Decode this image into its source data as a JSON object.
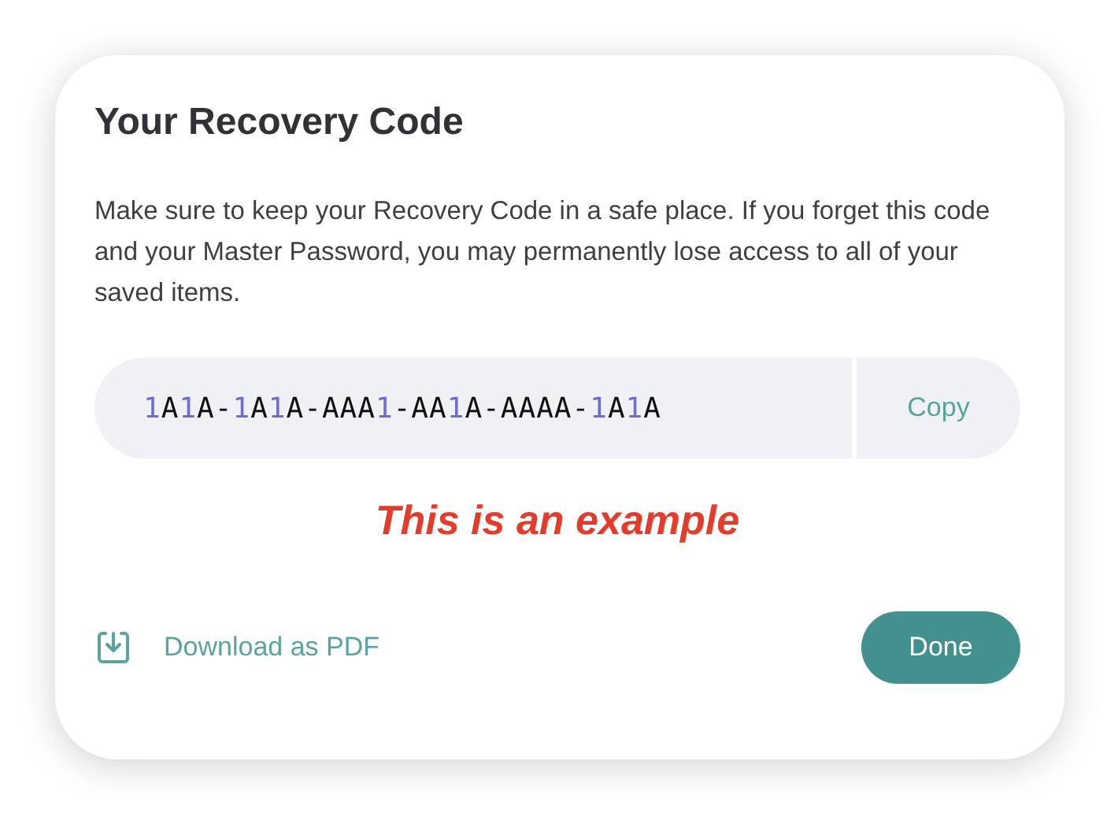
{
  "dialog": {
    "title": "Your Recovery Code",
    "message": "Make sure to keep your Recovery Code in a safe place. If you forget this code and your Master Password, you may permanently lose access to all of your saved items.",
    "code": "1A1A-1A1A-AAA1-AA1A-AAAA-1A1A",
    "copy_button": "Copy",
    "example_note": "This is an example",
    "download_link": "Download as PDF",
    "done_button": "Done"
  }
}
